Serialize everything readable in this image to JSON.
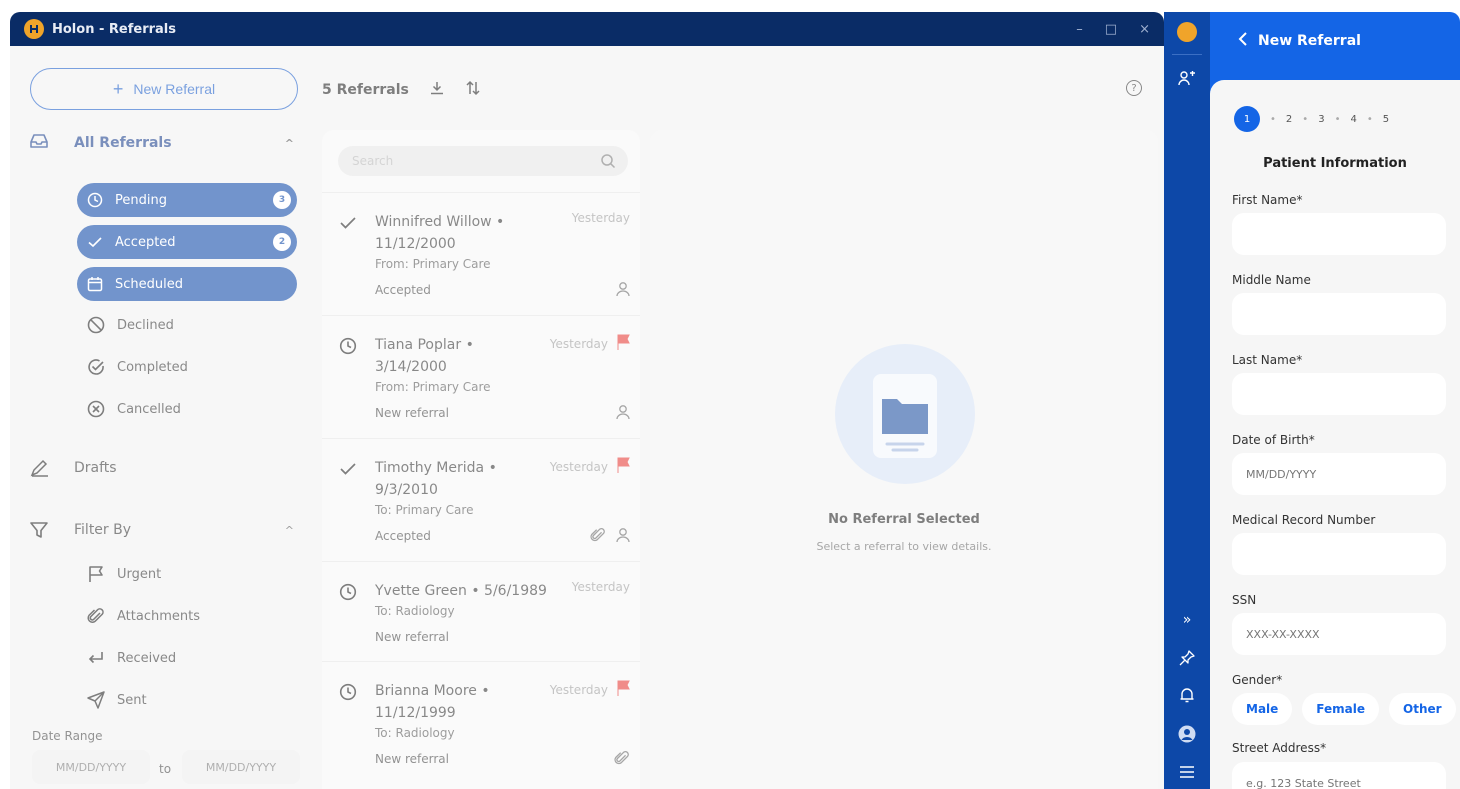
{
  "window": {
    "title": "Holon - Referrals",
    "controls": [
      "–",
      "□",
      "×"
    ]
  },
  "sidebar": {
    "new_referral": "New Referral",
    "all_referrals": "All Referrals",
    "items": [
      {
        "label": "Pending",
        "badge": "3"
      },
      {
        "label": "Accepted",
        "badge": "2"
      },
      {
        "label": "Scheduled"
      },
      {
        "label": "Declined"
      },
      {
        "label": "Completed"
      },
      {
        "label": "Cancelled"
      }
    ],
    "drafts": "Drafts",
    "filter_by": "Filter By",
    "filters": [
      "Urgent",
      "Attachments",
      "Received",
      "Sent"
    ],
    "date_range": {
      "label": "Date Range",
      "from_placeholder": "MM/DD/YYYY",
      "to": "to",
      "to_placeholder": "MM/DD/YYYY"
    }
  },
  "toolbar": {
    "count": "5 Referrals"
  },
  "list": {
    "search_placeholder": "Search",
    "rows": [
      {
        "name": "Winnifred Willow • 11/12/2000",
        "time": "Yesterday",
        "from": "From: Primary Care",
        "status": "Accepted",
        "icon": "check-icon"
      },
      {
        "name": "Tiana Poplar • 3/14/2000",
        "time": "Yesterday",
        "from": "From: Primary Care",
        "status": "New referral",
        "icon": "clock-icon",
        "urgent": true
      },
      {
        "name": "Timothy Merida • 9/3/2010",
        "time": "Yesterday",
        "from": "To: Primary Care",
        "status": "Accepted",
        "icon": "check-icon",
        "urgent": true
      },
      {
        "name": "Yvette Green • 5/6/1989",
        "time": "Yesterday",
        "from": "To: Radiology",
        "status": "New referral",
        "icon": "clock-icon"
      },
      {
        "name": "Brianna Moore • 11/12/1999",
        "time": "Yesterday",
        "from": "To: Radiology",
        "status": "New referral",
        "icon": "clock-icon",
        "urgent": true
      }
    ]
  },
  "detail": {
    "title": "No Referral Selected",
    "subtitle": "Select a referral to view details."
  },
  "panel": {
    "title": "New Referral",
    "steps": [
      "1",
      "2",
      "3",
      "4",
      "5"
    ],
    "section": "Patient Information",
    "fields": [
      {
        "label": "First Name*",
        "placeholder": ""
      },
      {
        "label": "Middle Name",
        "placeholder": ""
      },
      {
        "label": "Last Name*",
        "placeholder": ""
      },
      {
        "label": "Date of Birth*",
        "placeholder": "MM/DD/YYYY"
      },
      {
        "label": "Medical Record Number",
        "placeholder": ""
      },
      {
        "label": "SSN",
        "placeholder": "XXX-XX-XXXX"
      }
    ],
    "gender": {
      "label": "Gender*",
      "options": [
        "Male",
        "Female",
        "Other"
      ]
    },
    "street": {
      "label": "Street Address*",
      "placeholder": "e.g. 123 State Street"
    }
  },
  "colors": {
    "brand_navy": "#0a2c66",
    "brand_blue": "#0d48a8",
    "accent": "#1465e6",
    "flag_red": "#e53935",
    "logo_orange": "#f0a42a"
  }
}
